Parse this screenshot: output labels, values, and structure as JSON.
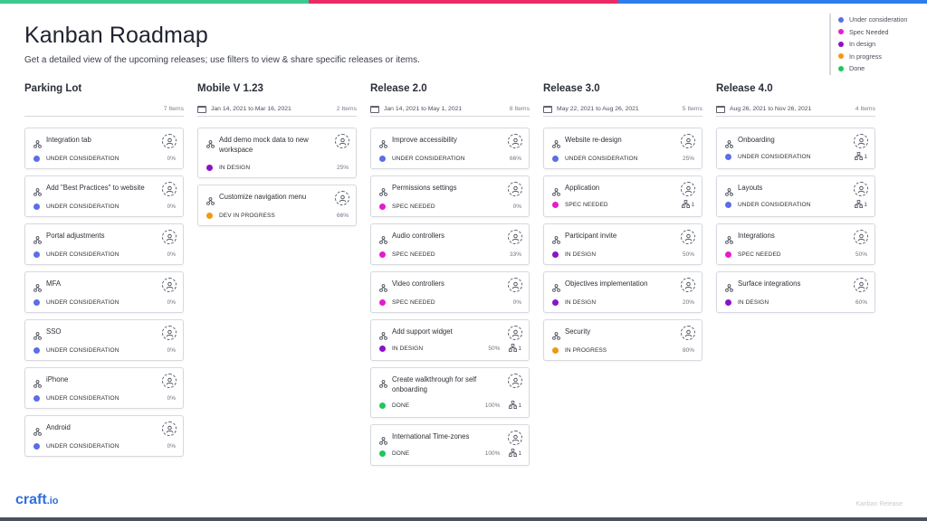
{
  "top_bar_colors": [
    "#3ec98e",
    "#ea2a67",
    "#2e7de9"
  ],
  "title": "Kanban Roadmap",
  "subtitle": "Get a detailed view of the upcoming releases; use filters to view & share specific releases or items.",
  "legend": [
    {
      "label": "Under consideration",
      "color": "#5b6ee8"
    },
    {
      "label": "Spec Needed",
      "color": "#e31ec9"
    },
    {
      "label": "In design",
      "color": "#8b12c9"
    },
    {
      "label": "In progress",
      "color": "#f09a12"
    },
    {
      "label": "Done",
      "color": "#22c55e"
    }
  ],
  "columns": [
    {
      "title": "Parking Lot",
      "dates": "",
      "count": "7 Items",
      "cards": [
        {
          "title": "Integration tab",
          "status": "UNDER CONSIDERATION",
          "color": "#5b6ee8",
          "pct": "0%",
          "sub": ""
        },
        {
          "title": "Add \"Best Practices\" to website",
          "status": "UNDER CONSIDERATION",
          "color": "#5b6ee8",
          "pct": "0%",
          "sub": ""
        },
        {
          "title": "Portal adjustments",
          "status": "UNDER CONSIDERATION",
          "color": "#5b6ee8",
          "pct": "0%",
          "sub": ""
        },
        {
          "title": "MFA",
          "status": "UNDER CONSIDERATION",
          "color": "#5b6ee8",
          "pct": "0%",
          "sub": ""
        },
        {
          "title": "SSO",
          "status": "UNDER CONSIDERATION",
          "color": "#5b6ee8",
          "pct": "0%",
          "sub": ""
        },
        {
          "title": "iPhone",
          "status": "UNDER CONSIDERATION",
          "color": "#5b6ee8",
          "pct": "0%",
          "sub": ""
        },
        {
          "title": "Android",
          "status": "UNDER CONSIDERATION",
          "color": "#5b6ee8",
          "pct": "0%",
          "sub": ""
        }
      ]
    },
    {
      "title": "Mobile V 1.23",
      "dates": "Jan 14, 2021 to Mar 16, 2021",
      "count": "2 Items",
      "cards": [
        {
          "title": "Add demo mock data to new workspace",
          "status": "IN DESIGN",
          "color": "#8b12c9",
          "pct": "25%",
          "sub": "",
          "tall": true
        },
        {
          "title": "Customize navigation menu",
          "status": "DEV IN PROGRESS",
          "color": "#f09a12",
          "pct": "66%",
          "sub": ""
        }
      ]
    },
    {
      "title": "Release 2.0",
      "dates": "Jan 14, 2021 to May 1, 2021",
      "count": "8 Items",
      "cards": [
        {
          "title": "Improve accessibility",
          "status": "UNDER CONSIDERATION",
          "color": "#5b6ee8",
          "pct": "66%",
          "sub": ""
        },
        {
          "title": "Permissions settings",
          "status": "SPEC NEEDED",
          "color": "#e31ec9",
          "pct": "0%",
          "sub": ""
        },
        {
          "title": "Audio controllers",
          "status": "SPEC NEEDED",
          "color": "#e31ec9",
          "pct": "33%",
          "sub": ""
        },
        {
          "title": "Video controllers",
          "status": "SPEC NEEDED",
          "color": "#e31ec9",
          "pct": "0%",
          "sub": ""
        },
        {
          "title": "Add support widget",
          "status": "IN DESIGN",
          "color": "#8b12c9",
          "pct": "50%",
          "sub": "1"
        },
        {
          "title": "Create walkthrough for self onboarding",
          "status": "DONE",
          "color": "#22c55e",
          "pct": "100%",
          "sub": "1",
          "tall": true
        },
        {
          "title": "International Time-zones",
          "status": "DONE",
          "color": "#22c55e",
          "pct": "100%",
          "sub": "1"
        }
      ]
    },
    {
      "title": "Release 3.0",
      "dates": "May 22, 2021 to Aug 26, 2021",
      "count": "5 Items",
      "cards": [
        {
          "title": "Website re-design",
          "status": "UNDER CONSIDERATION",
          "color": "#5b6ee8",
          "pct": "25%",
          "sub": ""
        },
        {
          "title": "Application",
          "status": "SPEC NEEDED",
          "color": "#e31ec9",
          "pct": "",
          "sub": "1"
        },
        {
          "title": "Participant invite",
          "status": "IN DESIGN",
          "color": "#8b12c9",
          "pct": "50%",
          "sub": ""
        },
        {
          "title": "Objectives implementation",
          "status": "IN DESIGN",
          "color": "#8b12c9",
          "pct": "20%",
          "sub": ""
        },
        {
          "title": "Security",
          "status": "IN PROGRESS",
          "color": "#f09a12",
          "pct": "80%",
          "sub": ""
        }
      ]
    },
    {
      "title": "Release 4.0",
      "dates": "Aug 26, 2021 to Nov 26, 2021",
      "count": "4 Items",
      "cards": [
        {
          "title": "Onboarding",
          "status": "UNDER CONSIDERATION",
          "color": "#5b6ee8",
          "pct": "",
          "sub": "1"
        },
        {
          "title": "Layouts",
          "status": "UNDER CONSIDERATION",
          "color": "#5b6ee8",
          "pct": "",
          "sub": "1"
        },
        {
          "title": "Integrations",
          "status": "SPEC NEEDED",
          "color": "#e31ec9",
          "pct": "50%",
          "sub": ""
        },
        {
          "title": "Surface integrations",
          "status": "IN DESIGN",
          "color": "#8b12c9",
          "pct": "60%",
          "sub": ""
        }
      ]
    }
  ],
  "logo": {
    "name": "craft",
    "suffix": ".io"
  },
  "watermark": "Kanban Release"
}
